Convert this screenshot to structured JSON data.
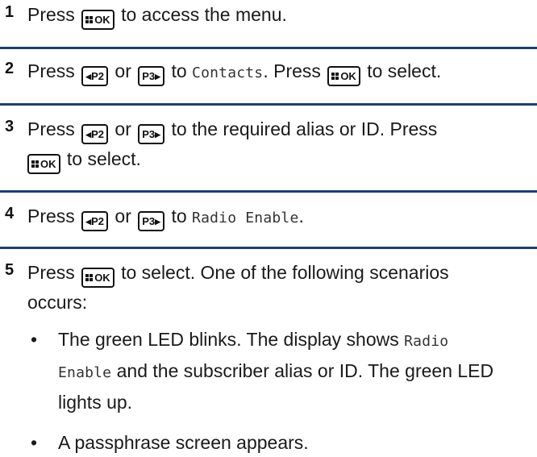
{
  "keys": {
    "ok": "OK",
    "p2": "P2",
    "p3": "P3"
  },
  "steps": [
    {
      "number": "1",
      "press": "Press",
      "text_after": " to access the menu."
    },
    {
      "number": "2",
      "press": "Press",
      "or": " or ",
      "to": " to ",
      "menu_item": "Contacts",
      "after_item": ". Press ",
      "end": " to select."
    },
    {
      "number": "3",
      "press": "Press",
      "or": " or ",
      "text_after": " to the required alias or ID. Press",
      "end": " to select."
    },
    {
      "number": "4",
      "press": "Press",
      "or": " or ",
      "to": " to ",
      "menu_item": "Radio Enable",
      "end": "."
    },
    {
      "number": "5",
      "press": "Press",
      "text_after": " to select. One of the following scenarios",
      "text_line2": "occurs:",
      "bullets": [
        {
          "marker": "•",
          "part1": "The green LED blinks. The display shows ",
          "mono_a": "Radio",
          "mono_b": "Enable",
          "part2": " and the subscriber alias or ID. The green LED lights up."
        },
        {
          "marker": "•",
          "part1": "A passphrase screen appears."
        }
      ]
    }
  ],
  "colors": {
    "separator": "#1f3f6e",
    "text": "#1a1a1a"
  }
}
